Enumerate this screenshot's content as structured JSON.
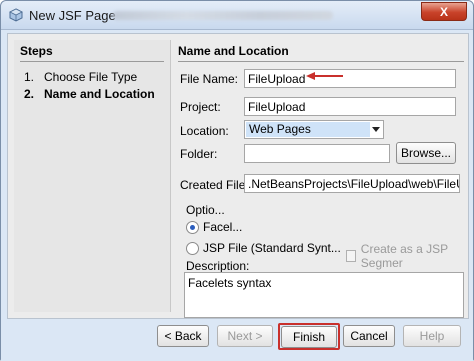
{
  "window": {
    "title": "New JSF Page",
    "close_label": "X"
  },
  "steps": {
    "heading": "Steps",
    "items": [
      {
        "num": "1.",
        "label": "Choose File Type",
        "current": false
      },
      {
        "num": "2.",
        "label": "Name and Location",
        "current": true
      }
    ]
  },
  "main": {
    "heading": "Name and Location",
    "file_name": {
      "label": "File Name:",
      "value": "FileUpload"
    },
    "project": {
      "label": "Project:",
      "value": "FileUpload"
    },
    "location": {
      "label": "Location:",
      "value": "Web Pages"
    },
    "folder": {
      "label": "Folder:",
      "value": "",
      "browse_label": "Browse..."
    },
    "created_file": {
      "label": "Created File:",
      "value": ".NetBeansProjects\\FileUpload\\web\\FileUpload."
    },
    "options": {
      "label": "Optio...",
      "radio_facelets": {
        "label": "Facel...",
        "selected": true
      },
      "radio_jsp": {
        "label": "JSP File (Standard Synt...",
        "selected": false
      },
      "checkbox_segment": {
        "label": "Create as a JSP Segmer",
        "checked": false
      }
    },
    "description": {
      "label": "Description:",
      "value": "Facelets syntax"
    }
  },
  "buttons": {
    "back": "< Back",
    "next": "Next >",
    "finish": "Finish",
    "cancel": "Cancel",
    "help": "Help"
  },
  "colors": {
    "highlight_red": "#c9302c",
    "selection_blue": "#cfe3f8"
  }
}
